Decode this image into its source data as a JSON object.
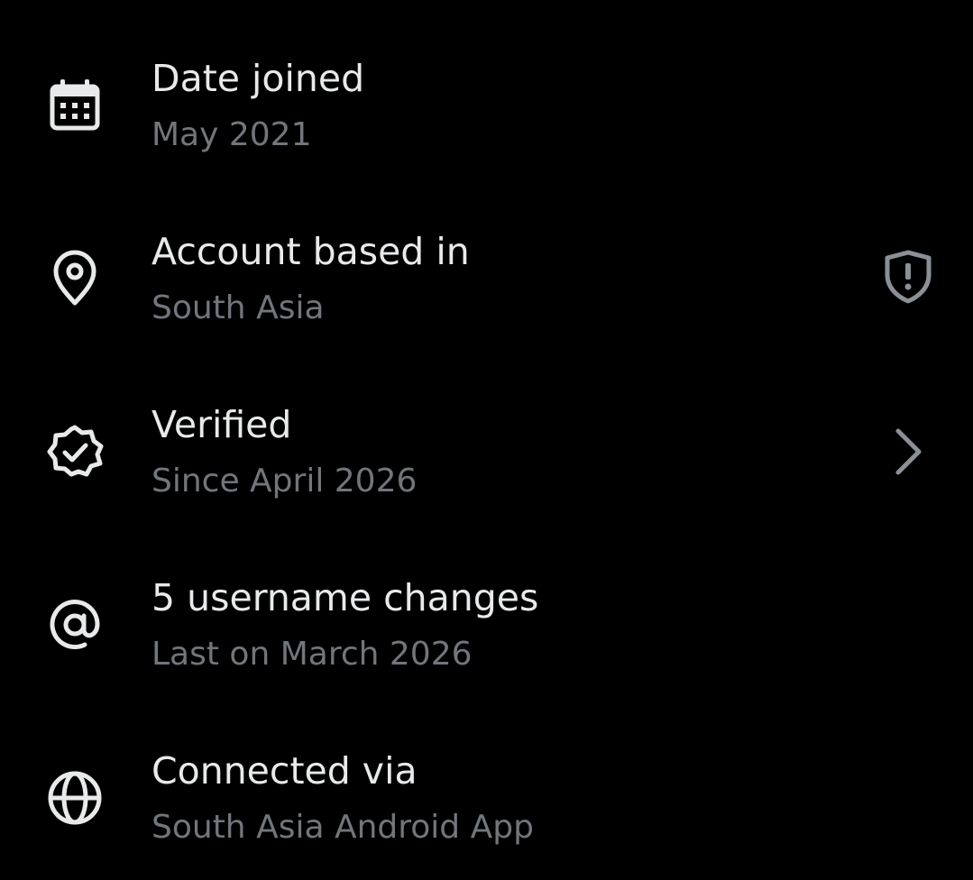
{
  "colors": {
    "background": "#000000",
    "primary_text": "#e7e9ea",
    "secondary_text": "#71767b",
    "icon": "#e7e9ea",
    "trailing_icon": "#8b9096"
  },
  "rows": [
    {
      "title": "Date joined",
      "subtitle": "May 2021",
      "icon": "calendar-icon"
    },
    {
      "title": "Account based in",
      "subtitle": "South Asia",
      "icon": "location-pin-icon",
      "trailing_icon": "shield-alert-icon"
    },
    {
      "title": "Verified",
      "subtitle": "Since April 2026",
      "icon": "verified-badge-icon",
      "trailing_icon": "chevron-right-icon"
    },
    {
      "title": "5 username changes",
      "subtitle": "Last on March 2026",
      "icon": "at-sign-icon"
    },
    {
      "title": "Connected via",
      "subtitle": "South Asia Android App",
      "icon": "globe-icon"
    }
  ]
}
